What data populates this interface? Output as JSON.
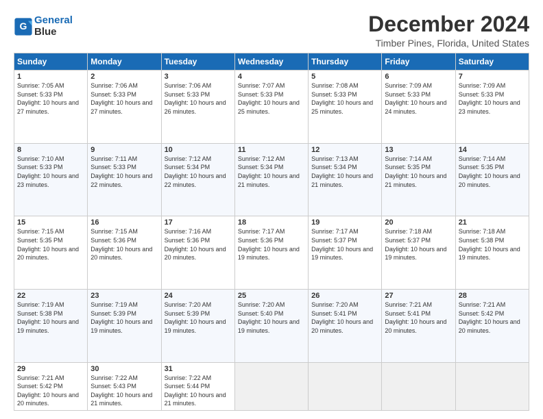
{
  "header": {
    "logo_line1": "General",
    "logo_line2": "Blue",
    "title": "December 2024",
    "subtitle": "Timber Pines, Florida, United States"
  },
  "columns": [
    "Sunday",
    "Monday",
    "Tuesday",
    "Wednesday",
    "Thursday",
    "Friday",
    "Saturday"
  ],
  "weeks": [
    [
      {
        "day": "1",
        "sunrise": "Sunrise: 7:05 AM",
        "sunset": "Sunset: 5:33 PM",
        "daylight": "Daylight: 10 hours and 27 minutes."
      },
      {
        "day": "2",
        "sunrise": "Sunrise: 7:06 AM",
        "sunset": "Sunset: 5:33 PM",
        "daylight": "Daylight: 10 hours and 27 minutes."
      },
      {
        "day": "3",
        "sunrise": "Sunrise: 7:06 AM",
        "sunset": "Sunset: 5:33 PM",
        "daylight": "Daylight: 10 hours and 26 minutes."
      },
      {
        "day": "4",
        "sunrise": "Sunrise: 7:07 AM",
        "sunset": "Sunset: 5:33 PM",
        "daylight": "Daylight: 10 hours and 25 minutes."
      },
      {
        "day": "5",
        "sunrise": "Sunrise: 7:08 AM",
        "sunset": "Sunset: 5:33 PM",
        "daylight": "Daylight: 10 hours and 25 minutes."
      },
      {
        "day": "6",
        "sunrise": "Sunrise: 7:09 AM",
        "sunset": "Sunset: 5:33 PM",
        "daylight": "Daylight: 10 hours and 24 minutes."
      },
      {
        "day": "7",
        "sunrise": "Sunrise: 7:09 AM",
        "sunset": "Sunset: 5:33 PM",
        "daylight": "Daylight: 10 hours and 23 minutes."
      }
    ],
    [
      {
        "day": "8",
        "sunrise": "Sunrise: 7:10 AM",
        "sunset": "Sunset: 5:33 PM",
        "daylight": "Daylight: 10 hours and 23 minutes."
      },
      {
        "day": "9",
        "sunrise": "Sunrise: 7:11 AM",
        "sunset": "Sunset: 5:33 PM",
        "daylight": "Daylight: 10 hours and 22 minutes."
      },
      {
        "day": "10",
        "sunrise": "Sunrise: 7:12 AM",
        "sunset": "Sunset: 5:34 PM",
        "daylight": "Daylight: 10 hours and 22 minutes."
      },
      {
        "day": "11",
        "sunrise": "Sunrise: 7:12 AM",
        "sunset": "Sunset: 5:34 PM",
        "daylight": "Daylight: 10 hours and 21 minutes."
      },
      {
        "day": "12",
        "sunrise": "Sunrise: 7:13 AM",
        "sunset": "Sunset: 5:34 PM",
        "daylight": "Daylight: 10 hours and 21 minutes."
      },
      {
        "day": "13",
        "sunrise": "Sunrise: 7:14 AM",
        "sunset": "Sunset: 5:35 PM",
        "daylight": "Daylight: 10 hours and 21 minutes."
      },
      {
        "day": "14",
        "sunrise": "Sunrise: 7:14 AM",
        "sunset": "Sunset: 5:35 PM",
        "daylight": "Daylight: 10 hours and 20 minutes."
      }
    ],
    [
      {
        "day": "15",
        "sunrise": "Sunrise: 7:15 AM",
        "sunset": "Sunset: 5:35 PM",
        "daylight": "Daylight: 10 hours and 20 minutes."
      },
      {
        "day": "16",
        "sunrise": "Sunrise: 7:15 AM",
        "sunset": "Sunset: 5:36 PM",
        "daylight": "Daylight: 10 hours and 20 minutes."
      },
      {
        "day": "17",
        "sunrise": "Sunrise: 7:16 AM",
        "sunset": "Sunset: 5:36 PM",
        "daylight": "Daylight: 10 hours and 20 minutes."
      },
      {
        "day": "18",
        "sunrise": "Sunrise: 7:17 AM",
        "sunset": "Sunset: 5:36 PM",
        "daylight": "Daylight: 10 hours and 19 minutes."
      },
      {
        "day": "19",
        "sunrise": "Sunrise: 7:17 AM",
        "sunset": "Sunset: 5:37 PM",
        "daylight": "Daylight: 10 hours and 19 minutes."
      },
      {
        "day": "20",
        "sunrise": "Sunrise: 7:18 AM",
        "sunset": "Sunset: 5:37 PM",
        "daylight": "Daylight: 10 hours and 19 minutes."
      },
      {
        "day": "21",
        "sunrise": "Sunrise: 7:18 AM",
        "sunset": "Sunset: 5:38 PM",
        "daylight": "Daylight: 10 hours and 19 minutes."
      }
    ],
    [
      {
        "day": "22",
        "sunrise": "Sunrise: 7:19 AM",
        "sunset": "Sunset: 5:38 PM",
        "daylight": "Daylight: 10 hours and 19 minutes."
      },
      {
        "day": "23",
        "sunrise": "Sunrise: 7:19 AM",
        "sunset": "Sunset: 5:39 PM",
        "daylight": "Daylight: 10 hours and 19 minutes."
      },
      {
        "day": "24",
        "sunrise": "Sunrise: 7:20 AM",
        "sunset": "Sunset: 5:39 PM",
        "daylight": "Daylight: 10 hours and 19 minutes."
      },
      {
        "day": "25",
        "sunrise": "Sunrise: 7:20 AM",
        "sunset": "Sunset: 5:40 PM",
        "daylight": "Daylight: 10 hours and 19 minutes."
      },
      {
        "day": "26",
        "sunrise": "Sunrise: 7:20 AM",
        "sunset": "Sunset: 5:41 PM",
        "daylight": "Daylight: 10 hours and 20 minutes."
      },
      {
        "day": "27",
        "sunrise": "Sunrise: 7:21 AM",
        "sunset": "Sunset: 5:41 PM",
        "daylight": "Daylight: 10 hours and 20 minutes."
      },
      {
        "day": "28",
        "sunrise": "Sunrise: 7:21 AM",
        "sunset": "Sunset: 5:42 PM",
        "daylight": "Daylight: 10 hours and 20 minutes."
      }
    ],
    [
      {
        "day": "29",
        "sunrise": "Sunrise: 7:21 AM",
        "sunset": "Sunset: 5:42 PM",
        "daylight": "Daylight: 10 hours and 20 minutes."
      },
      {
        "day": "30",
        "sunrise": "Sunrise: 7:22 AM",
        "sunset": "Sunset: 5:43 PM",
        "daylight": "Daylight: 10 hours and 21 minutes."
      },
      {
        "day": "31",
        "sunrise": "Sunrise: 7:22 AM",
        "sunset": "Sunset: 5:44 PM",
        "daylight": "Daylight: 10 hours and 21 minutes."
      },
      {
        "day": "",
        "sunrise": "",
        "sunset": "",
        "daylight": ""
      },
      {
        "day": "",
        "sunrise": "",
        "sunset": "",
        "daylight": ""
      },
      {
        "day": "",
        "sunrise": "",
        "sunset": "",
        "daylight": ""
      },
      {
        "day": "",
        "sunrise": "",
        "sunset": "",
        "daylight": ""
      }
    ]
  ]
}
